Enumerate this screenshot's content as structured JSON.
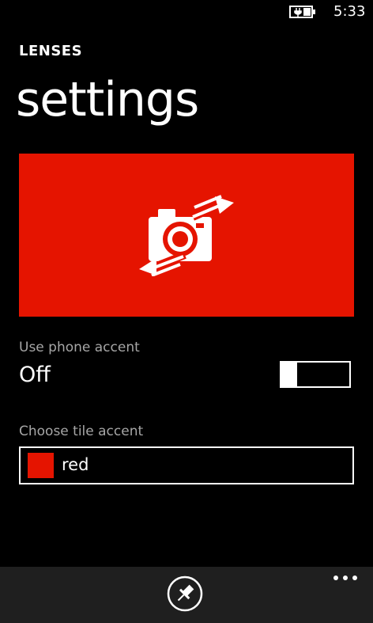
{
  "status_bar": {
    "time": "5:33",
    "battery_icon": "battery-charging-icon"
  },
  "header": {
    "app_title": "LENSES",
    "page_title": "settings"
  },
  "tile": {
    "icon": "camera-swap-icon",
    "color": "#e51400"
  },
  "phone_accent": {
    "label": "Use phone accent",
    "state": "Off"
  },
  "tile_accent": {
    "label": "Choose tile accent",
    "selected": "red",
    "swatch_color": "#e51400"
  },
  "app_bar": {
    "pin_icon": "pin-icon",
    "more_icon": "more-icon"
  }
}
